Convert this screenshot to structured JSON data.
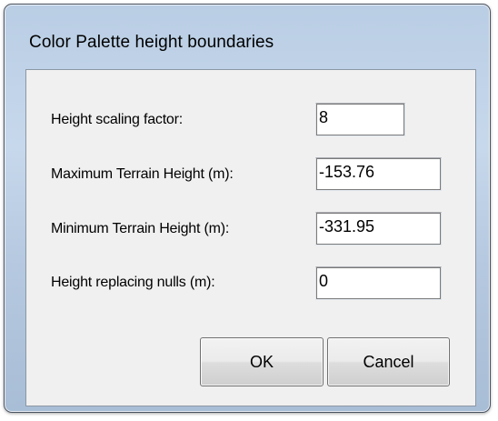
{
  "dialog": {
    "title": "Color Palette height boundaries"
  },
  "fields": [
    {
      "label": "Height scaling factor:",
      "value": "8"
    },
    {
      "label": "Maximum Terrain Height (m):",
      "value": "-153.76"
    },
    {
      "label": "Minimum Terrain Height (m):",
      "value": "-331.95"
    },
    {
      "label": "Height replacing nulls (m):",
      "value": "0"
    }
  ],
  "buttons": {
    "ok": "OK",
    "cancel": "Cancel"
  },
  "colors": {
    "frame": "#b9cde4",
    "client_background": "#f0f0f0",
    "text": "#000000"
  }
}
